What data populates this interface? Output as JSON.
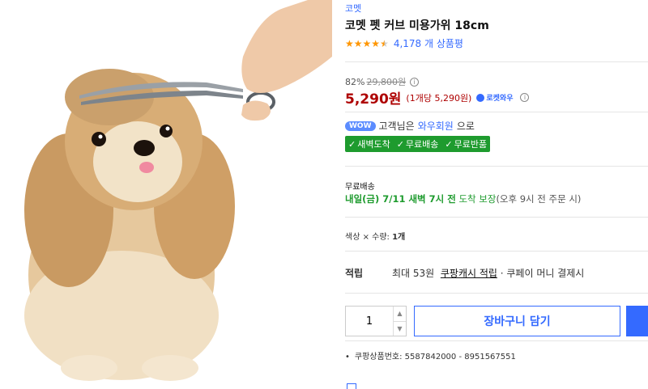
{
  "product": {
    "brand": "코멧",
    "title": "코멧 펫 커브 미용가위 18cm",
    "rating": 4.5,
    "review_count": "4,178 개 상품평"
  },
  "price": {
    "discount": "82%",
    "original": "29,800원",
    "sale": "5,290원",
    "unit": "(1개당 5,290원)",
    "rocket_label": "로켓와우"
  },
  "wow": {
    "badge": "WOW",
    "text_before": "고객님은",
    "link": "와우회원",
    "text_after": "으로",
    "benefits": [
      "새벽도착",
      "무료배송",
      "무료반품"
    ]
  },
  "shipping": {
    "label": "무료배송",
    "arrival": "내일(금) 7/11 새벽 7시 전",
    "guarantee": "도착 보장",
    "cutoff": "(오후 9시 전 주문 시)"
  },
  "option": {
    "label": "색상 × 수량:",
    "value": "1개"
  },
  "cash": {
    "label": "적립",
    "text1": "최대 53원",
    "link": "쿠팡캐시 적립",
    "text2": "· 쿠페이 머니 결제시"
  },
  "purchase": {
    "quantity": "1",
    "cart_label": "장바구니 담기"
  },
  "meta": {
    "product_number": "쿠팡상품번호: 5587842000 - 8951567551"
  },
  "colors": {
    "accent": "#346aff",
    "price": "#ae0000",
    "wow_green": "#1e9b2e",
    "star": "#ff9600"
  }
}
